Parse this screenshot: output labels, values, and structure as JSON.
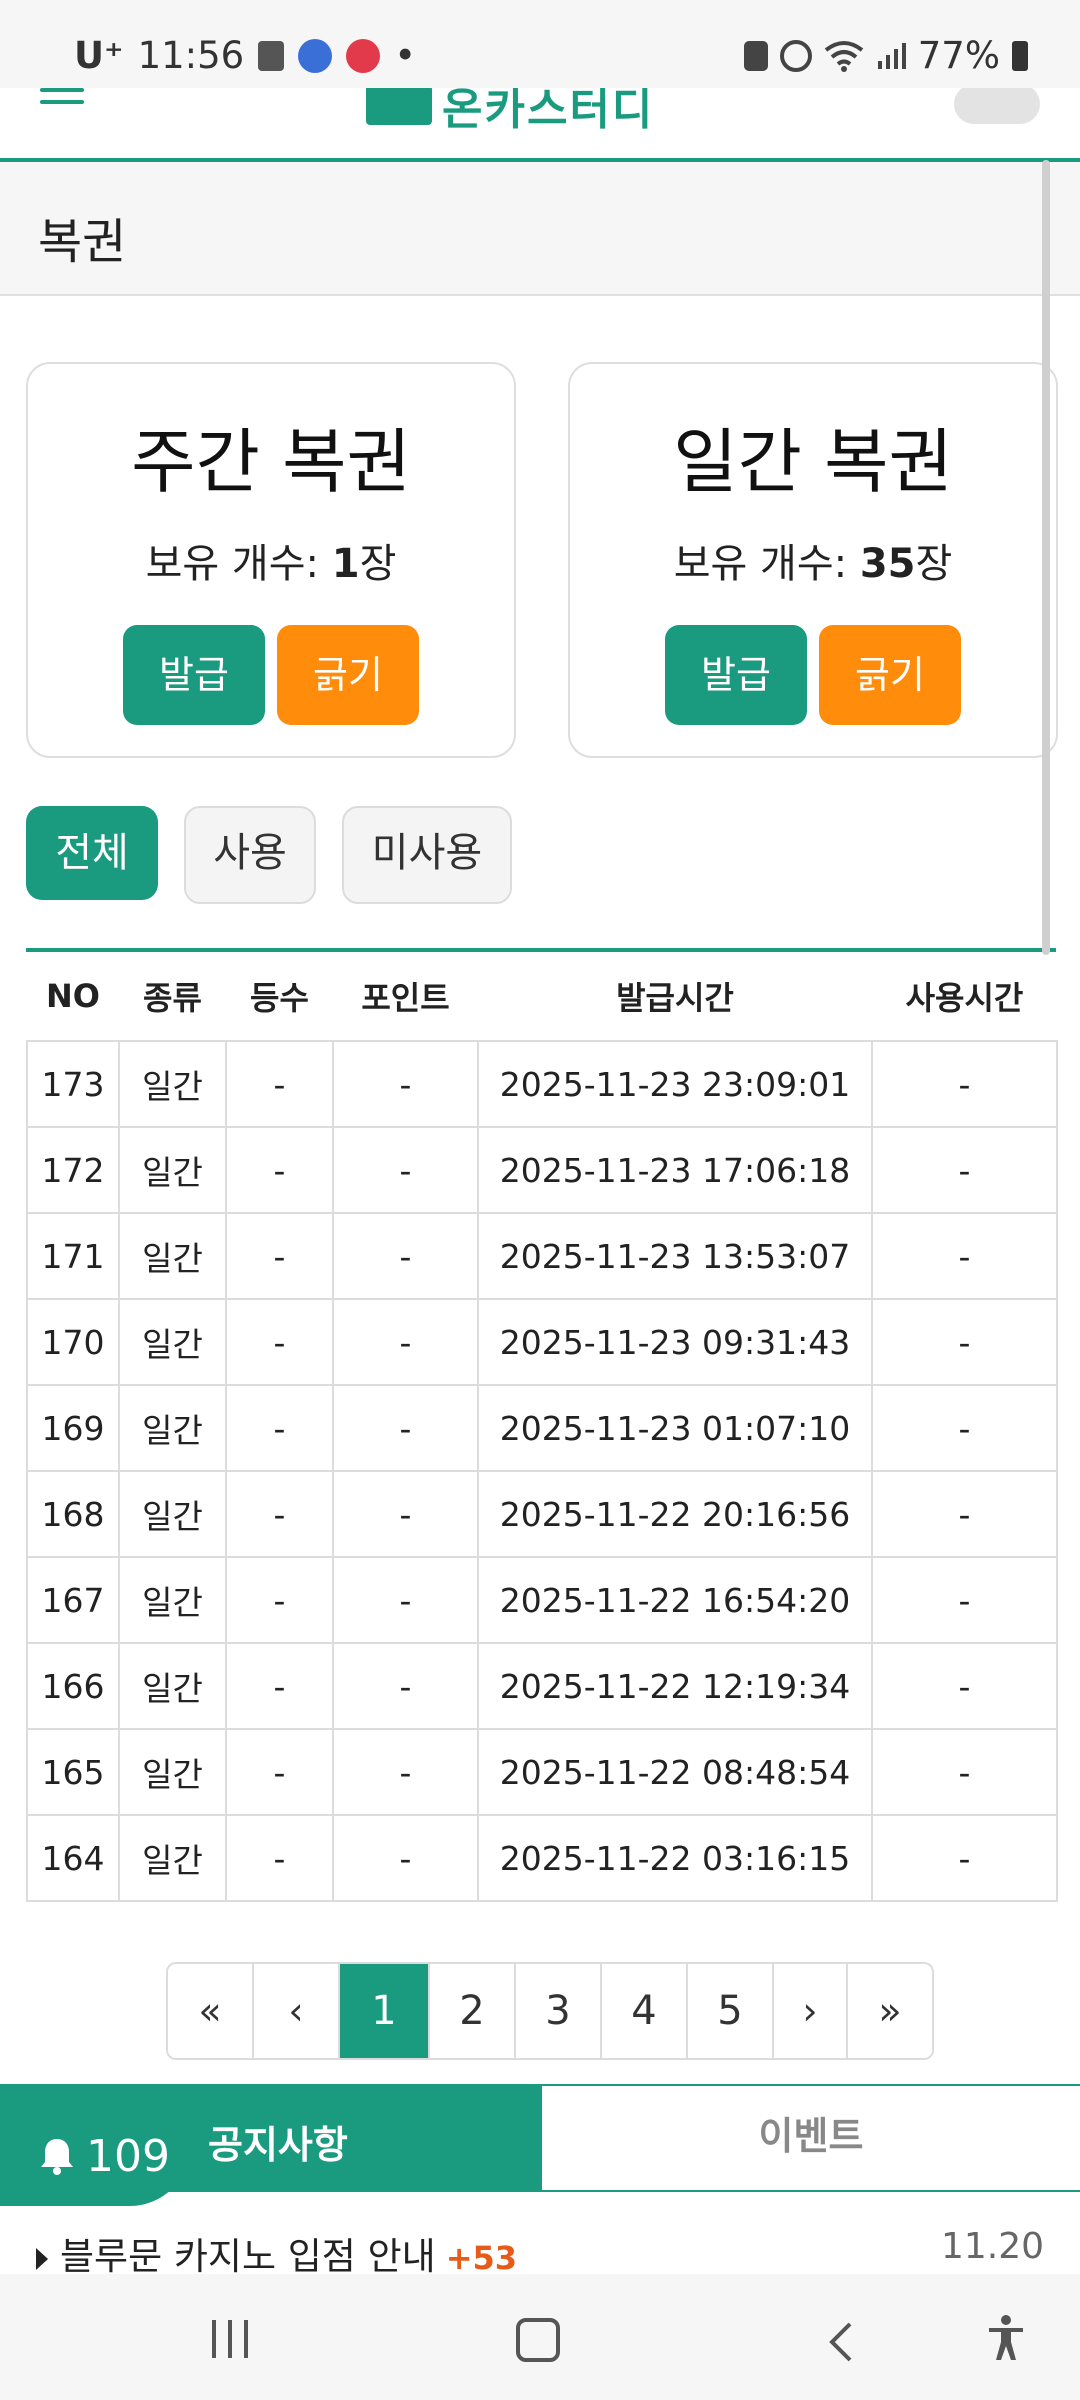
{
  "status_bar": {
    "carrier": "U⁺",
    "time": "11:56",
    "battery": "77%"
  },
  "header": {
    "logo_text": "온카스터디"
  },
  "page": {
    "title": "복권"
  },
  "cards": [
    {
      "title": "주간 복권",
      "count_label": "보유 개수: ",
      "count_value": "1",
      "count_unit": "장",
      "issue_label": "발급",
      "scratch_label": "긁기"
    },
    {
      "title": "일간 복권",
      "count_label": "보유 개수: ",
      "count_value": "35",
      "count_unit": "장",
      "issue_label": "발급",
      "scratch_label": "긁기"
    }
  ],
  "filters": [
    "전체",
    "사용",
    "미사용"
  ],
  "table": {
    "headers": [
      "NO",
      "종류",
      "등수",
      "포인트",
      "발급시간",
      "사용시간"
    ],
    "rows": [
      [
        "173",
        "일간",
        "-",
        "-",
        "2025-11-23 23:09:01",
        "-"
      ],
      [
        "172",
        "일간",
        "-",
        "-",
        "2025-11-23 17:06:18",
        "-"
      ],
      [
        "171",
        "일간",
        "-",
        "-",
        "2025-11-23 13:53:07",
        "-"
      ],
      [
        "170",
        "일간",
        "-",
        "-",
        "2025-11-23 09:31:43",
        "-"
      ],
      [
        "169",
        "일간",
        "-",
        "-",
        "2025-11-23 01:07:10",
        "-"
      ],
      [
        "168",
        "일간",
        "-",
        "-",
        "2025-11-22 20:16:56",
        "-"
      ],
      [
        "167",
        "일간",
        "-",
        "-",
        "2025-11-22 16:54:20",
        "-"
      ],
      [
        "166",
        "일간",
        "-",
        "-",
        "2025-11-22 12:19:34",
        "-"
      ],
      [
        "165",
        "일간",
        "-",
        "-",
        "2025-11-22 08:48:54",
        "-"
      ],
      [
        "164",
        "일간",
        "-",
        "-",
        "2025-11-22 03:16:15",
        "-"
      ]
    ]
  },
  "pagination": {
    "first": "«",
    "prev": "‹",
    "pages": [
      "1",
      "2",
      "3",
      "4",
      "5"
    ],
    "next": "›",
    "last": "»",
    "current": "1"
  },
  "notice": {
    "badge_count": "109",
    "tab_notice": "공지사항",
    "tab_event": "이벤트",
    "item_title": "블루문 카지노 입점 안내",
    "item_count": "+53",
    "item_date": "11.20"
  },
  "colors": {
    "accent": "#1a9b7f",
    "orange": "#ff8c0a",
    "notice_plus": "#e85a17"
  }
}
